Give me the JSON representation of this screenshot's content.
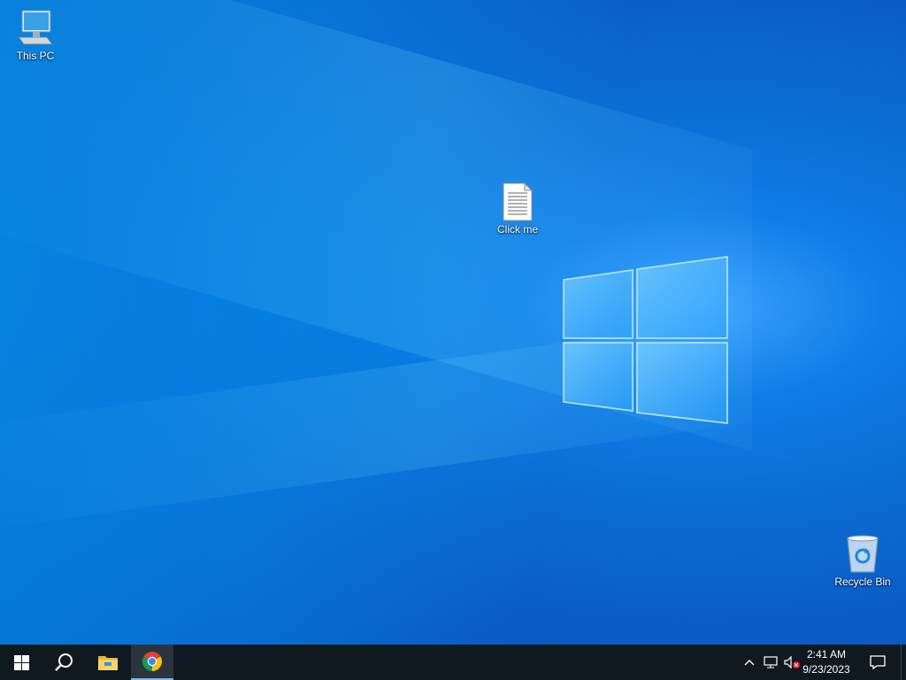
{
  "desktop": {
    "icons": [
      {
        "label": "This PC",
        "icon": "this-pc-icon"
      },
      {
        "label": "Click me",
        "icon": "text-file-icon"
      },
      {
        "label": "Recycle Bin",
        "icon": "recycle-bin-icon"
      }
    ]
  },
  "taskbar": {
    "start": {
      "icon": "windows-start-icon"
    },
    "search": {
      "icon": "search-icon"
    },
    "pinned": [
      {
        "icon": "file-explorer-icon"
      },
      {
        "icon": "chrome-icon",
        "active": true
      }
    ],
    "tray": {
      "icons": [
        "chevron-up-icon",
        "network-icon",
        "volume-muted-icon"
      ],
      "time": "2:41 AM",
      "date": "9/23/2023",
      "notification_icon": "action-center-icon"
    }
  },
  "colors": {
    "taskbar_bg": "#101820",
    "accent": "#76b9ed",
    "desktop_blue": "#0a6fd6"
  }
}
